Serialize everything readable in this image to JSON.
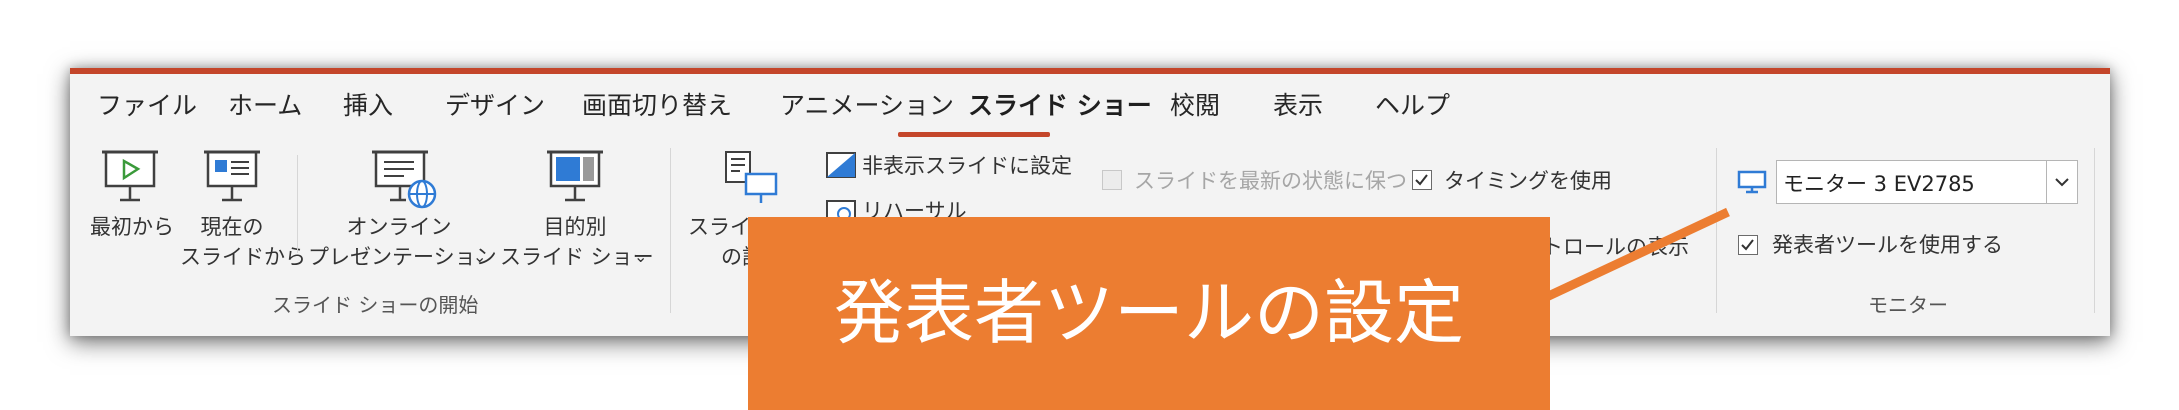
{
  "tabs": [
    "ファイル",
    "ホーム",
    "挿入",
    "デザイン",
    "画面切り替え",
    "アニメーション",
    "スライド ショー",
    "校閲",
    "表示",
    "ヘルプ"
  ],
  "active_tab": "スライド ショー",
  "start_group": {
    "from_beginning": "最初から",
    "from_current_1": "現在の",
    "from_current_2": "スライドから",
    "online_1": "オンライン",
    "online_2": "プレゼンテーション",
    "custom_1": "目的別",
    "custom_2": "スライド ショー",
    "group_label": "スライド ショーの開始"
  },
  "setup_group": {
    "setup_1": "スライド",
    "setup_2": "の設",
    "hide_slide": "非表示スライドに設定",
    "rehearse": "リハーサル",
    "keep_updated": "スライドを最新の状態に保つ",
    "use_timings": "タイミングを使用",
    "show_controls": "コントロールの表示"
  },
  "monitor_group": {
    "monitor_select": "モニター 3 EV2785",
    "use_presenter_view": "発表者ツールを使用する",
    "group_label": "モニター"
  },
  "callout": {
    "text": "発表者ツールの設定",
    "color": "#ec7d31"
  },
  "colors": {
    "accent": "#c4462a",
    "icon_blue": "#2f7bd5"
  }
}
